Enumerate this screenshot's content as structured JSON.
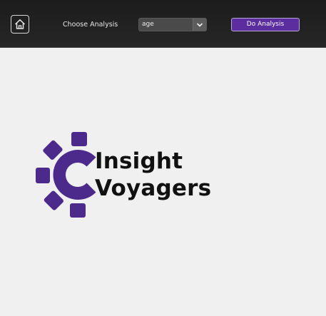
{
  "header": {
    "home_icon": "home-icon",
    "choose_label": "Choose Analysis",
    "analysis_select": {
      "value": "age",
      "icon": "chevron-down-icon"
    },
    "do_button_label": "Do Analysis"
  },
  "logo": {
    "line1": "Insight",
    "line2": "Voyagers",
    "gear_icon": "gear-icon",
    "accent_color": "#4b2a8c"
  },
  "colors": {
    "header_bg": "#222222",
    "button_purple": "#5b2d9e",
    "page_bg": "#f0f0f0"
  }
}
